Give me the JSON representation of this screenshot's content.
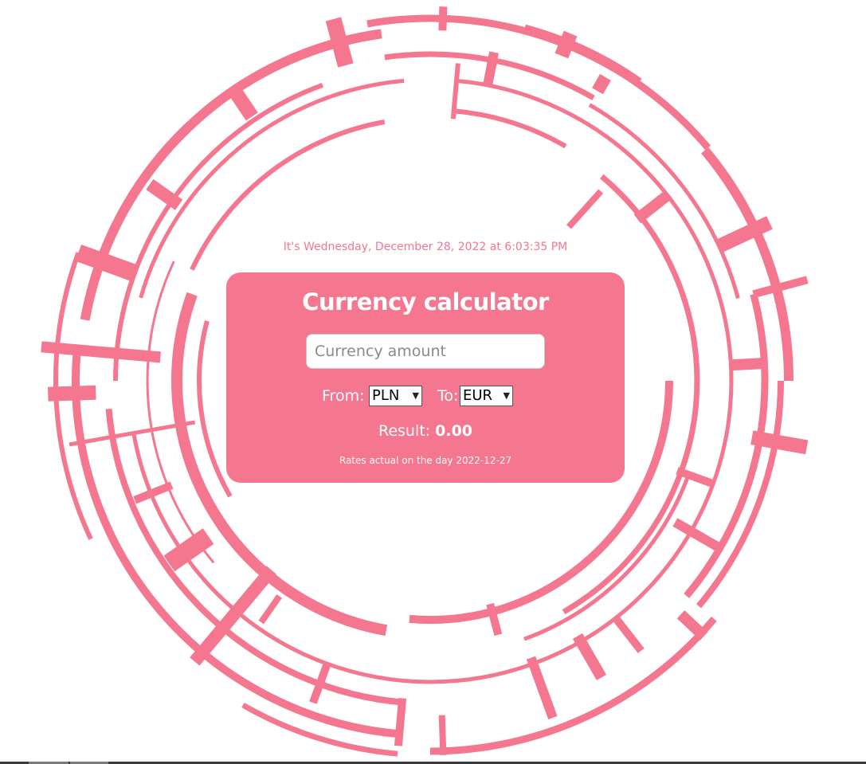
{
  "header": {
    "datetime_text": "It's Wednesday, December 28, 2022 at 6:03:35 PM"
  },
  "calculator": {
    "title": "Currency calculator",
    "amount_placeholder": "Currency amount",
    "amount_value": "",
    "from_label": "From:",
    "from_selected": "PLN",
    "to_label": "To:",
    "to_selected": "EUR",
    "dropdown_icon": "chevron-down-icon",
    "result_label": "Result:",
    "result_value": "0.00",
    "rates_text": "Rates actual on the day 2022-12-27"
  },
  "theme": {
    "accent": "#f4768f",
    "panel_text": "#ffffff",
    "background": "#ffffff"
  }
}
